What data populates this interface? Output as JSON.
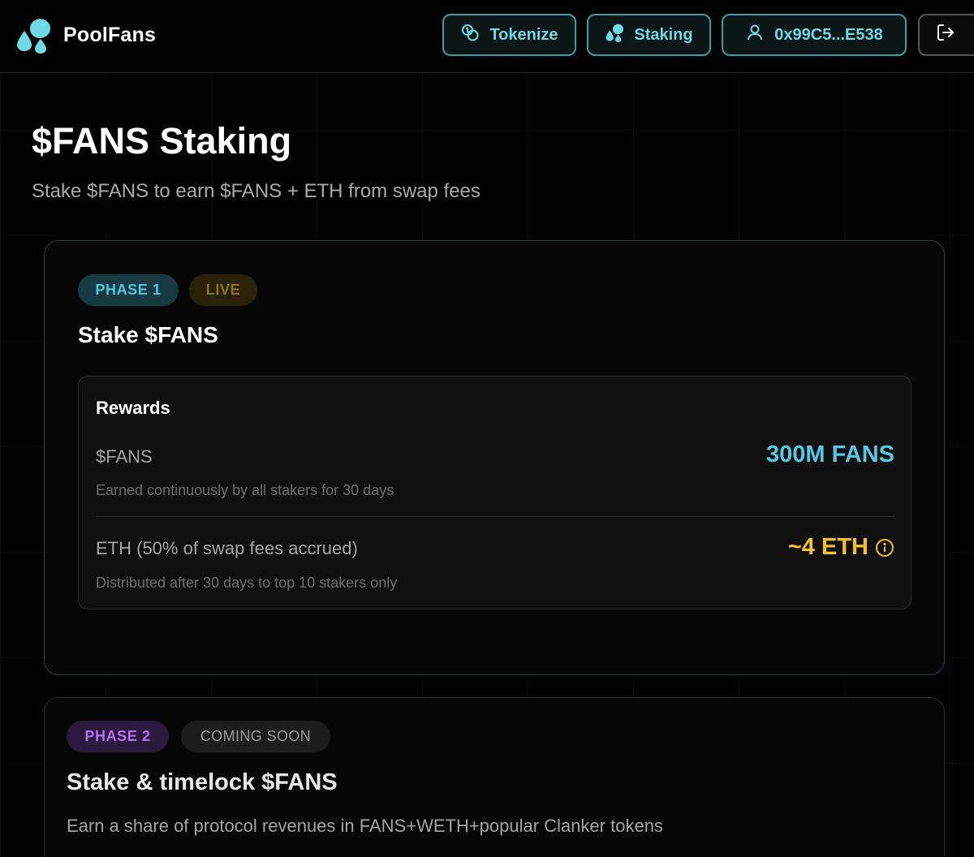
{
  "header": {
    "brand_name": "PoolFans",
    "nav": {
      "tokenize_label": "Tokenize",
      "staking_label": "Staking",
      "wallet_label": "0x99C5...E538"
    }
  },
  "page": {
    "title": "$FANS Staking",
    "subtitle": "Stake $FANS to earn $FANS + ETH from swap fees"
  },
  "phase1": {
    "phase_label": "PHASE 1",
    "status_label": "LIVE",
    "title": "Stake $FANS",
    "rewards": {
      "title": "Rewards",
      "fans": {
        "name": "$FANS",
        "value": "300M FANS",
        "description": "Earned continuously by all stakers for 30 days"
      },
      "eth": {
        "name": "ETH (50% of swap fees accrued)",
        "value": "~4 ETH",
        "description": "Distributed after 30 days to top 10 stakers only"
      }
    }
  },
  "phase2": {
    "phase_label": "PHASE 2",
    "status_label": "COMING SOON",
    "title": "Stake & timelock $FANS",
    "description": "Earn a share of protocol revenues in FANS+WETH+popular Clanker tokens"
  },
  "colors": {
    "accent_cyan": "#58c7e2",
    "eth_gold": "#f4c027",
    "phase2_purple": "#b66ff0"
  },
  "icons": {
    "brand": "droplets-logo-icon",
    "tokenize": "coins-icon",
    "staking": "droplets-icon",
    "wallet": "user-icon",
    "logout": "logout-icon",
    "eth_info": "info-icon"
  }
}
